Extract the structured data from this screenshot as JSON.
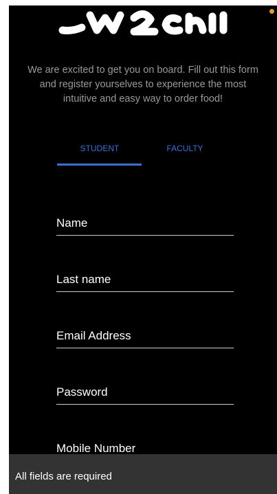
{
  "intro": {
    "line1": "We are excited to get you on board. Fill out this form",
    "line2": "and register yourselves to experience the most",
    "line3": "intuitive and easy way to order food!"
  },
  "tabs": [
    {
      "label": "STUDENT",
      "selected": true
    },
    {
      "label": "FACULTY",
      "selected": false
    }
  ],
  "form": {
    "name_placeholder": "Name",
    "last_name_placeholder": "Last name",
    "email_placeholder": "Email Address",
    "password_placeholder": "Password",
    "mobile_placeholder": "Mobile Number"
  },
  "snackbar": {
    "message": "All fields are required"
  },
  "colors": {
    "background": "#000000",
    "accent": "#3f6fd6",
    "intro_text": "#9a9a9a",
    "snackbar_bg": "#333333",
    "status_dot": "#e59b2c"
  },
  "icons": {
    "logo": "app-logo-icon",
    "status": "notification-dot-icon"
  }
}
